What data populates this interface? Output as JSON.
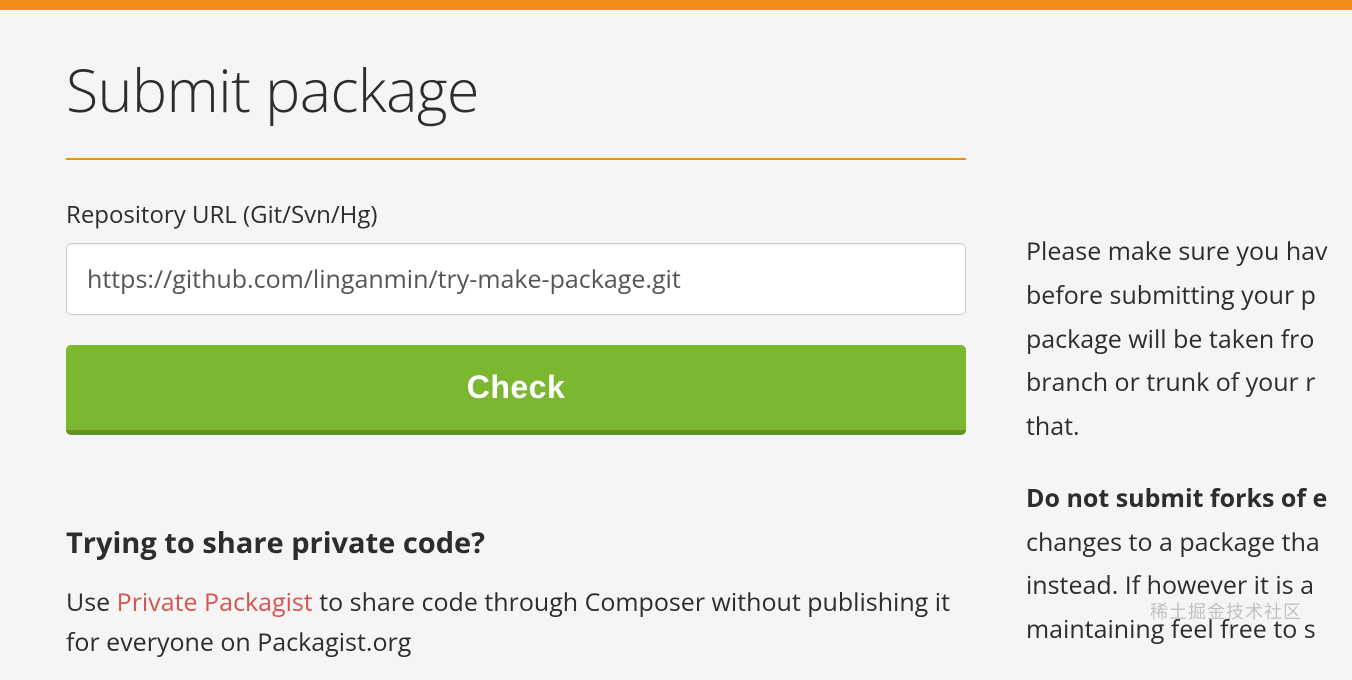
{
  "page": {
    "title": "Submit package"
  },
  "form": {
    "repo_label": "Repository URL (Git/Svn/Hg)",
    "repo_value": "https://github.com/linganmin/try-make-package.git",
    "check_button": "Check"
  },
  "private_section": {
    "heading": "Trying to share private code?",
    "text_before": "Use ",
    "link_text": "Private Packagist",
    "text_after": " to share code through Composer without publishing it for everyone on Packagist.org"
  },
  "sidebar": {
    "para1_line1": "Please make sure you hav",
    "para1_line2": "before submitting your p",
    "para1_line3": "package will be taken fro",
    "para1_line4": "branch or trunk of your r",
    "para1_line5": "that.",
    "para2_bold": "Do not submit forks of e",
    "para2_line2": "changes to a package tha",
    "para2_line3": "instead. If however it is a",
    "para2_line4": "maintaining feel free to s"
  },
  "watermark": "稀土掘金技术社区"
}
